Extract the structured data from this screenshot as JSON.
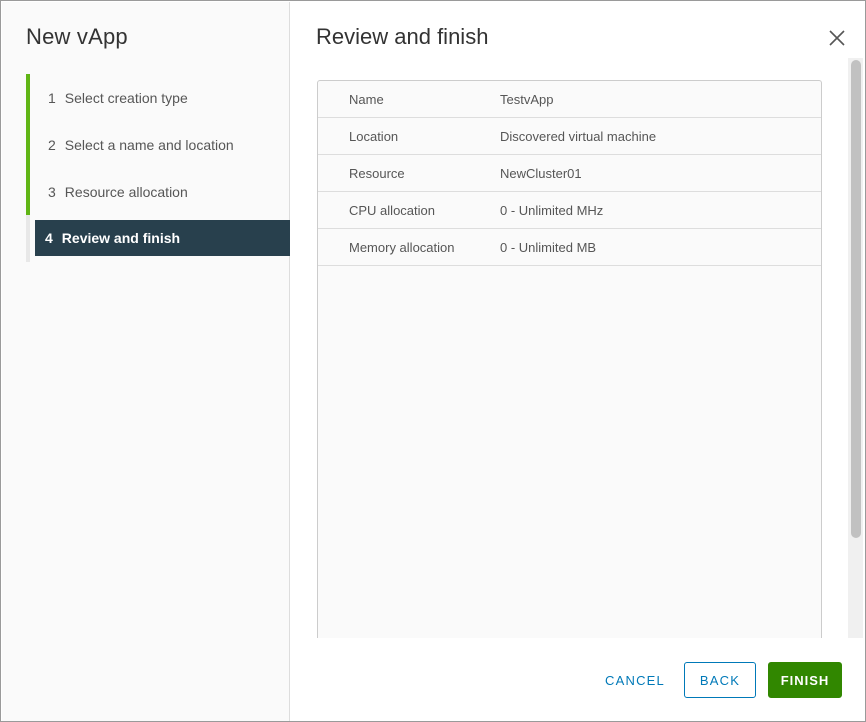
{
  "dialog": {
    "title": "New vApp",
    "steps": [
      {
        "num": "1",
        "label": "Select creation type",
        "state": "done"
      },
      {
        "num": "2",
        "label": "Select a name and location",
        "state": "done"
      },
      {
        "num": "3",
        "label": "Resource allocation",
        "state": "done"
      },
      {
        "num": "4",
        "label": "Review and finish",
        "state": "active"
      }
    ]
  },
  "content": {
    "title": "Review and finish",
    "close_icon": "close-icon",
    "rows": [
      {
        "key": "Name",
        "value": "TestvApp"
      },
      {
        "key": "Location",
        "value": "Discovered virtual machine"
      },
      {
        "key": "Resource",
        "value": "NewCluster01"
      },
      {
        "key": "CPU allocation",
        "value": "0 - Unlimited MHz"
      },
      {
        "key": "Memory allocation",
        "value": "0 - Unlimited MB"
      }
    ]
  },
  "footer": {
    "cancel_label": "CANCEL",
    "back_label": "BACK",
    "finish_label": "FINISH"
  },
  "colors": {
    "step_complete": "#60b515",
    "step_active_bg": "#28404d",
    "primary_blue": "#0079b8",
    "finish_green": "#318700"
  }
}
